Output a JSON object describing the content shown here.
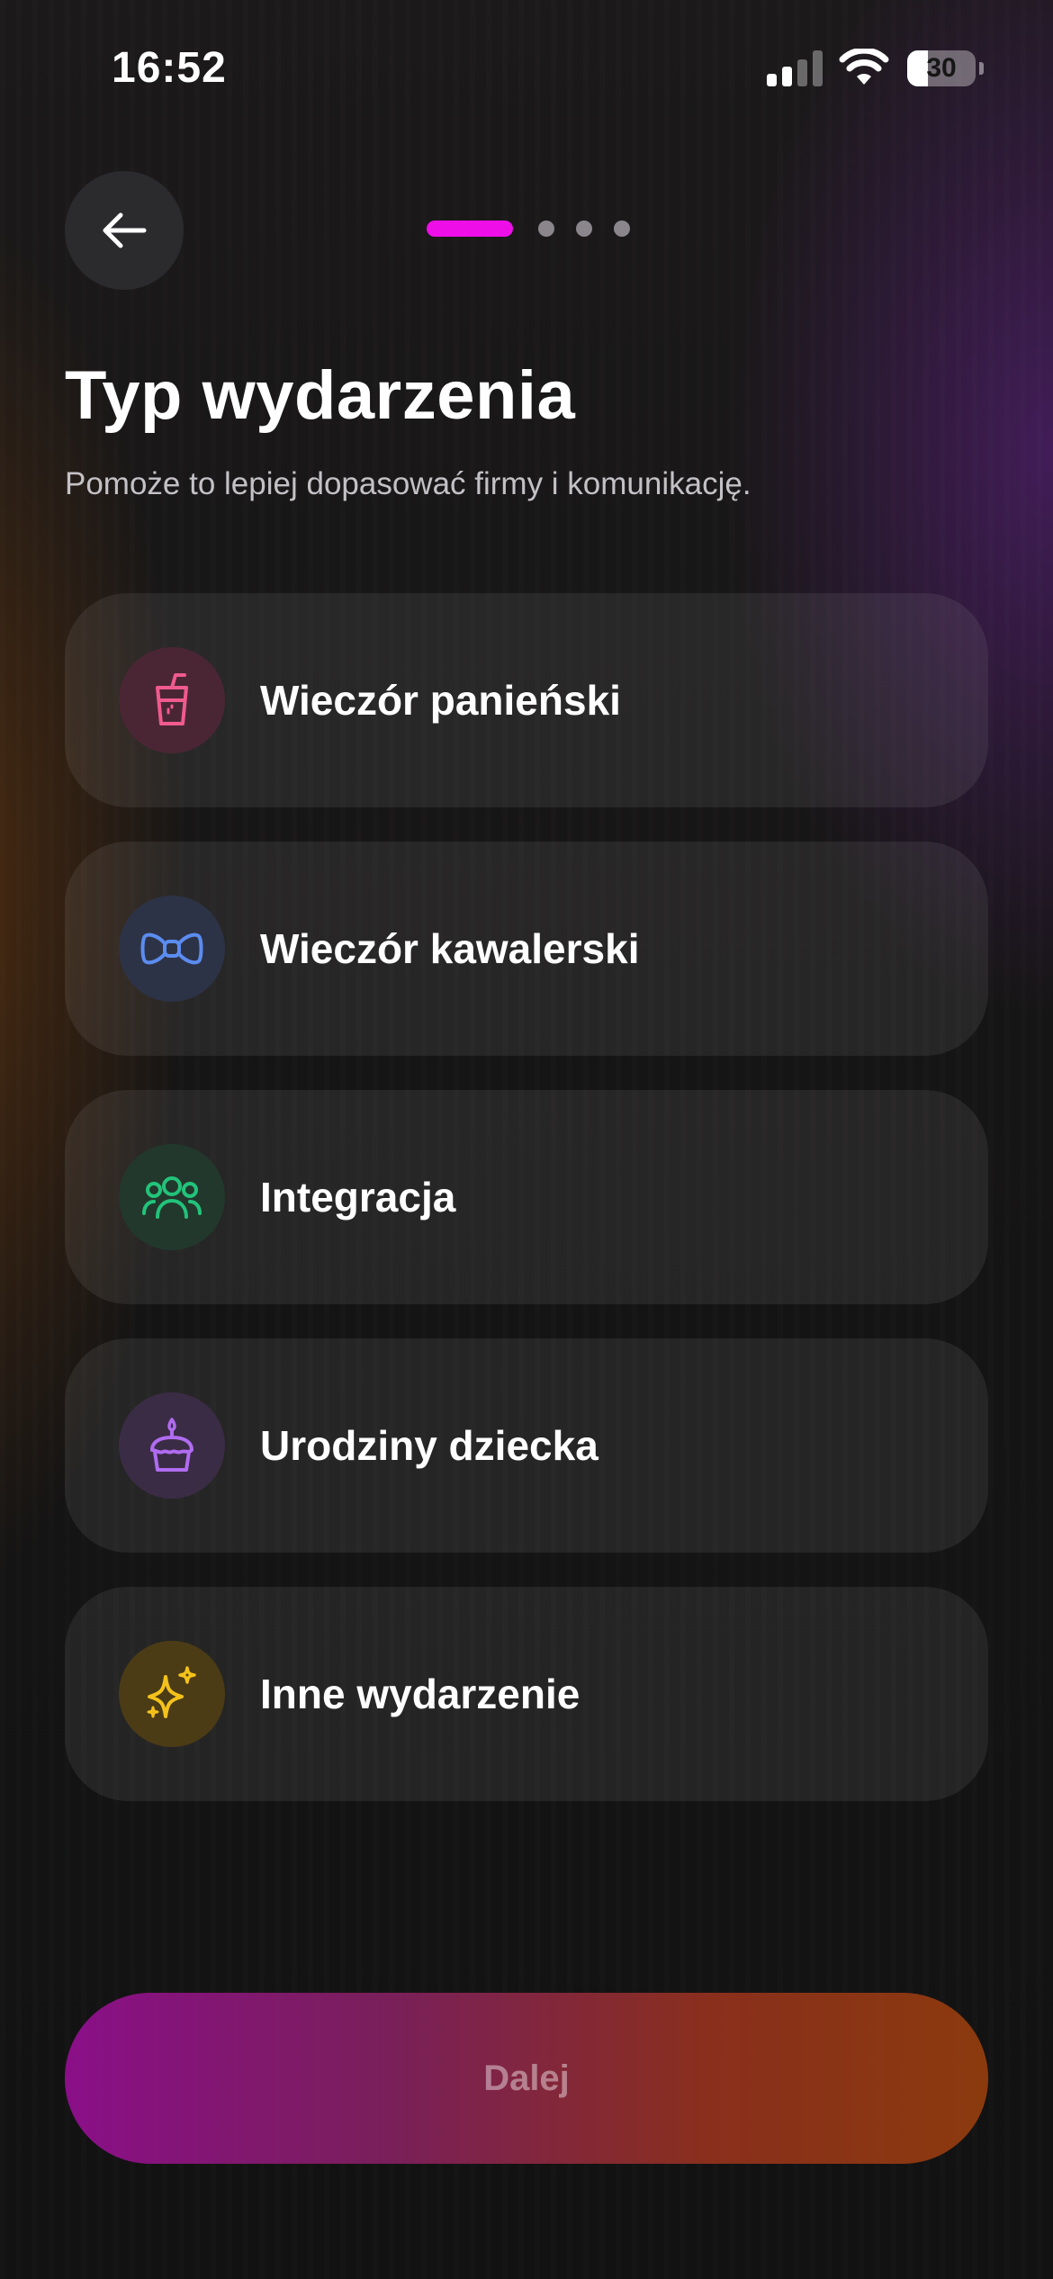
{
  "status_bar": {
    "time": "16:52",
    "battery_level": "30",
    "battery_fraction": 0.3
  },
  "header": {
    "back_icon": "arrow-left-icon",
    "progress": {
      "current_step": 1,
      "total_steps": 4,
      "active_color": "#ee0ee8"
    }
  },
  "main": {
    "title": "Typ wydarzenia",
    "subtitle": "Pomoże to lepiej dopasować firmy i komunikację."
  },
  "options": [
    {
      "label": "Wieczór panieński",
      "icon": "drink-glass-icon",
      "accent": "#f05a8c",
      "icon_bg": "#4a2635"
    },
    {
      "label": "Wieczór kawalerski",
      "icon": "bow-tie-icon",
      "accent": "#5b8cf0",
      "icon_bg": "#2d3346"
    },
    {
      "label": "Integracja",
      "icon": "users-group-icon",
      "accent": "#22c37a",
      "icon_bg": "#22382d"
    },
    {
      "label": "Urodziny dziecka",
      "icon": "birthday-cake-icon",
      "accent": "#b06cf0",
      "icon_bg": "#3b2c46"
    },
    {
      "label": "Inne wydarzenie",
      "icon": "sparkles-icon",
      "accent": "#f4c21a",
      "icon_bg": "#4b3c16"
    }
  ],
  "footer": {
    "continue_label": "Dalej"
  }
}
